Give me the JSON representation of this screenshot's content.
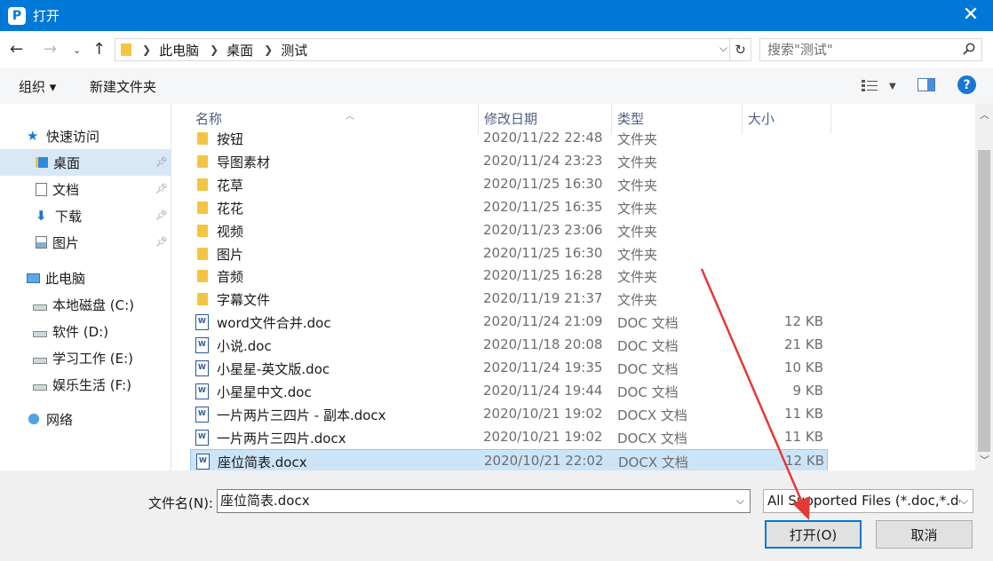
{
  "window": {
    "title": "打开",
    "logo_glyph": "P"
  },
  "address": {
    "breadcrumb": [
      "此电脑",
      "桌面",
      "测试"
    ],
    "search_placeholder": "搜索\"测试\""
  },
  "toolbar": {
    "organize": "组织 ▾",
    "new_folder": "新建文件夹"
  },
  "sidebar": {
    "items": [
      {
        "label": "快速访问",
        "icon": "star-icon"
      },
      {
        "label": "桌面",
        "icon": "desktop-icon",
        "pinned": true,
        "selected": true
      },
      {
        "label": "文档",
        "icon": "documents-icon",
        "pinned": true
      },
      {
        "label": "下载",
        "icon": "download-icon",
        "pinned": true
      },
      {
        "label": "图片",
        "icon": "pictures-icon",
        "pinned": true
      },
      {
        "label": "此电脑",
        "icon": "computer-icon"
      },
      {
        "label": "本地磁盘 (C:)",
        "icon": "drive-icon"
      },
      {
        "label": "软件 (D:)",
        "icon": "drive-icon"
      },
      {
        "label": "学习工作 (E:)",
        "icon": "drive-icon"
      },
      {
        "label": "娱乐生活 (F:)",
        "icon": "drive-icon"
      },
      {
        "label": "网络",
        "icon": "network-icon"
      }
    ]
  },
  "columns": {
    "name": "名称",
    "modified": "修改日期",
    "type": "类型",
    "size": "大小"
  },
  "files": [
    {
      "name": "按钮",
      "date": "2020/11/22 22:48",
      "type": "文件夹",
      "size": "",
      "kind": "folder"
    },
    {
      "name": "导图素材",
      "date": "2020/11/24 23:23",
      "type": "文件夹",
      "size": "",
      "kind": "folder"
    },
    {
      "name": "花草",
      "date": "2020/11/25 16:30",
      "type": "文件夹",
      "size": "",
      "kind": "folder"
    },
    {
      "name": "花花",
      "date": "2020/11/25 16:35",
      "type": "文件夹",
      "size": "",
      "kind": "folder"
    },
    {
      "name": "视频",
      "date": "2020/11/23 23:06",
      "type": "文件夹",
      "size": "",
      "kind": "folder"
    },
    {
      "name": "图片",
      "date": "2020/11/25 16:30",
      "type": "文件夹",
      "size": "",
      "kind": "folder"
    },
    {
      "name": "音频",
      "date": "2020/11/25 16:28",
      "type": "文件夹",
      "size": "",
      "kind": "folder"
    },
    {
      "name": "字幕文件",
      "date": "2020/11/19 21:37",
      "type": "文件夹",
      "size": "",
      "kind": "folder"
    },
    {
      "name": "word文件合并.doc",
      "date": "2020/11/24 21:09",
      "type": "DOC 文档",
      "size": "12 KB",
      "kind": "doc"
    },
    {
      "name": "小说.doc",
      "date": "2020/11/18 20:08",
      "type": "DOC 文档",
      "size": "21 KB",
      "kind": "doc"
    },
    {
      "name": "小星星-英文版.doc",
      "date": "2020/11/24 19:35",
      "type": "DOC 文档",
      "size": "10 KB",
      "kind": "doc"
    },
    {
      "name": "小星星中文.doc",
      "date": "2020/11/24 19:44",
      "type": "DOC 文档",
      "size": "9 KB",
      "kind": "doc"
    },
    {
      "name": "一片两片三四片 - 副本.docx",
      "date": "2020/10/21 19:02",
      "type": "DOCX 文档",
      "size": "11 KB",
      "kind": "doc"
    },
    {
      "name": "一片两片三四片.docx",
      "date": "2020/10/21 19:02",
      "type": "DOCX 文档",
      "size": "11 KB",
      "kind": "doc"
    },
    {
      "name": "座位简表.docx",
      "date": "2020/10/21 22:02",
      "type": "DOCX 文档",
      "size": "12 KB",
      "kind": "doc",
      "selected": true
    }
  ],
  "bottom": {
    "filename_label": "文件名(N):",
    "filename_value": "座位简表.docx",
    "filter_value": "All Supported Files (*.doc,*.dc",
    "open_label": "打开(O)",
    "cancel_label": "取消"
  },
  "colors": {
    "accent": "#0078d7",
    "selection": "#cce4f7",
    "annotation": "#e53935"
  }
}
